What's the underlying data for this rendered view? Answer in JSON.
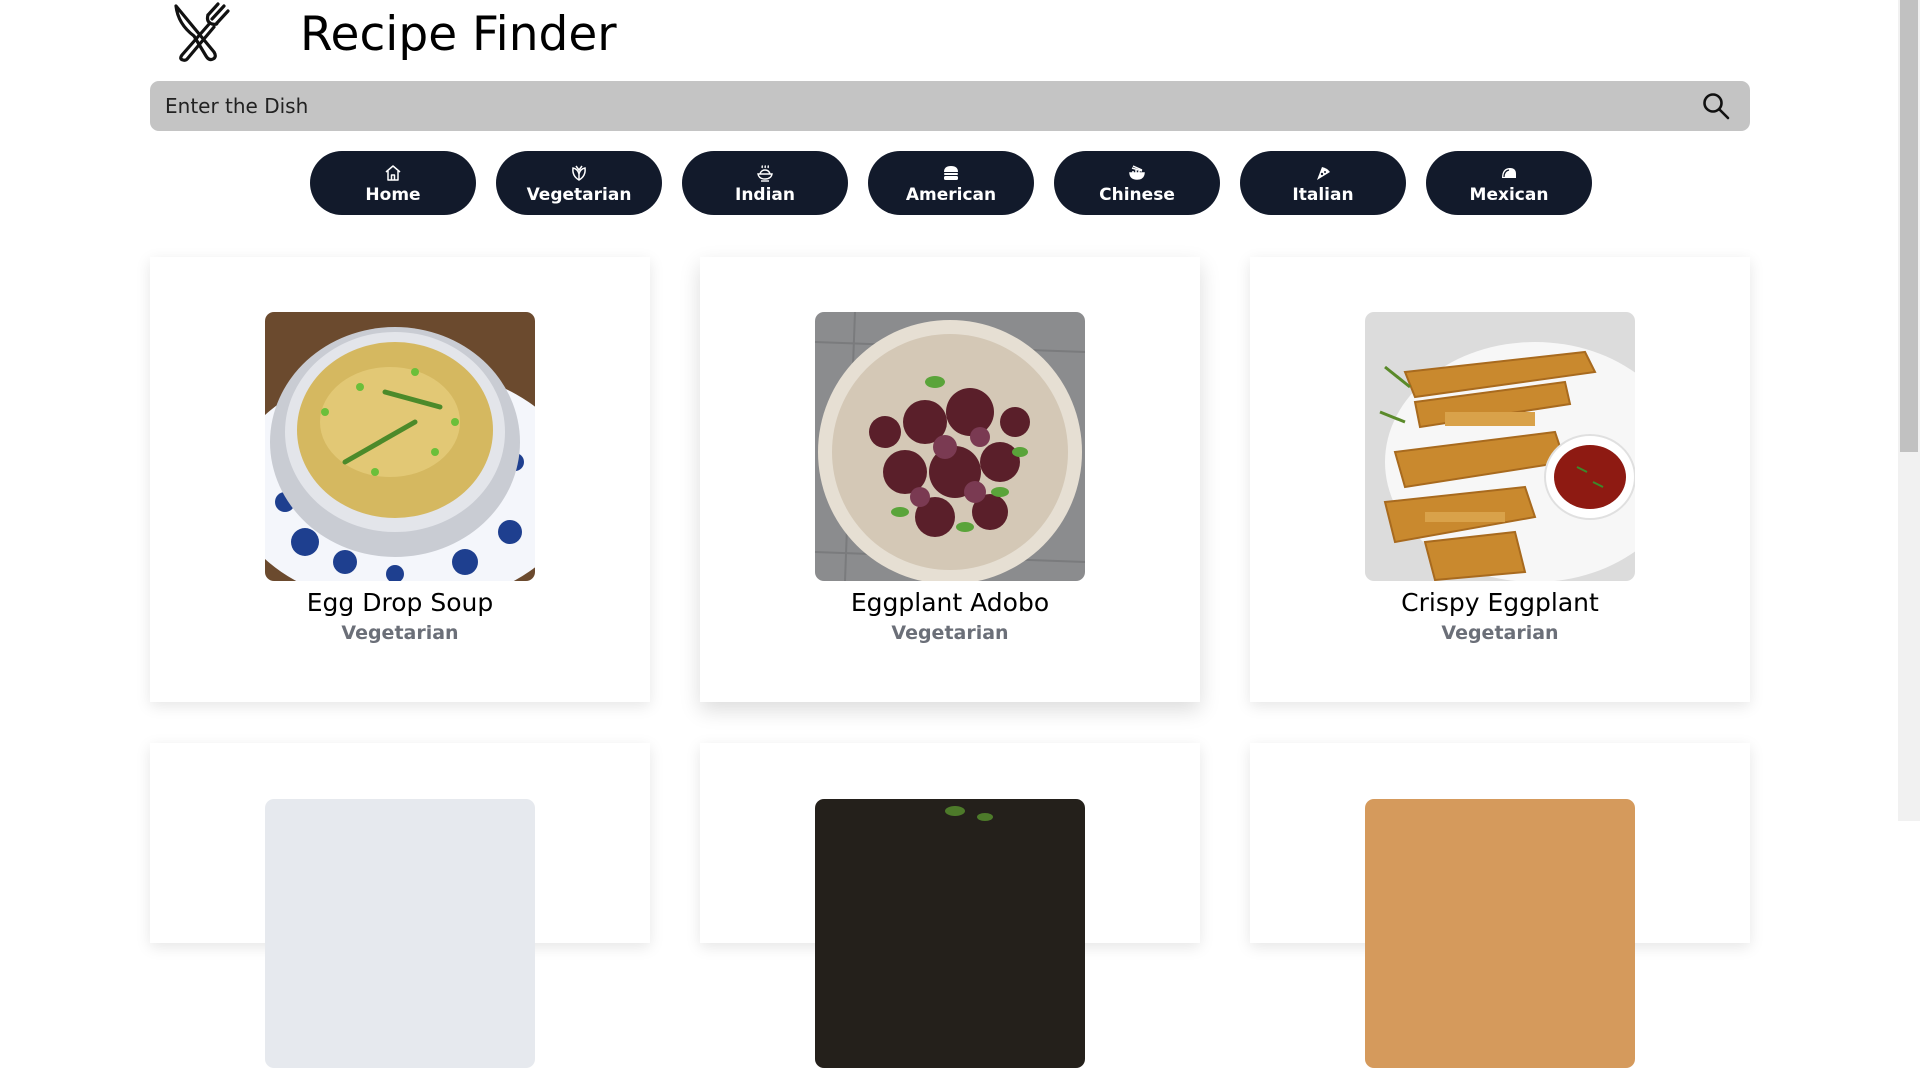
{
  "header": {
    "title": "Recipe Finder",
    "logo_icon": "fork-knife-icon"
  },
  "search": {
    "placeholder": "Enter the Dish",
    "icon": "search-icon"
  },
  "categories": [
    {
      "label": "Home",
      "icon": "home-icon"
    },
    {
      "label": "Vegetarian",
      "icon": "vegetable-icon"
    },
    {
      "label": "Indian",
      "icon": "indian-food-icon"
    },
    {
      "label": "American",
      "icon": "burger-icon"
    },
    {
      "label": "Chinese",
      "icon": "noodle-bowl-icon"
    },
    {
      "label": "Italian",
      "icon": "pizza-icon"
    },
    {
      "label": "Mexican",
      "icon": "taco-icon"
    }
  ],
  "recipes": [
    {
      "name": "Egg Drop Soup",
      "category": "Vegetarian"
    },
    {
      "name": "Eggplant Adobo",
      "category": "Vegetarian"
    },
    {
      "name": "Crispy Eggplant",
      "category": "Vegetarian"
    }
  ],
  "colors": {
    "button_bg": "#121a2b",
    "search_bg": "#c4c4c4",
    "tag_text": "#6b6f78"
  }
}
